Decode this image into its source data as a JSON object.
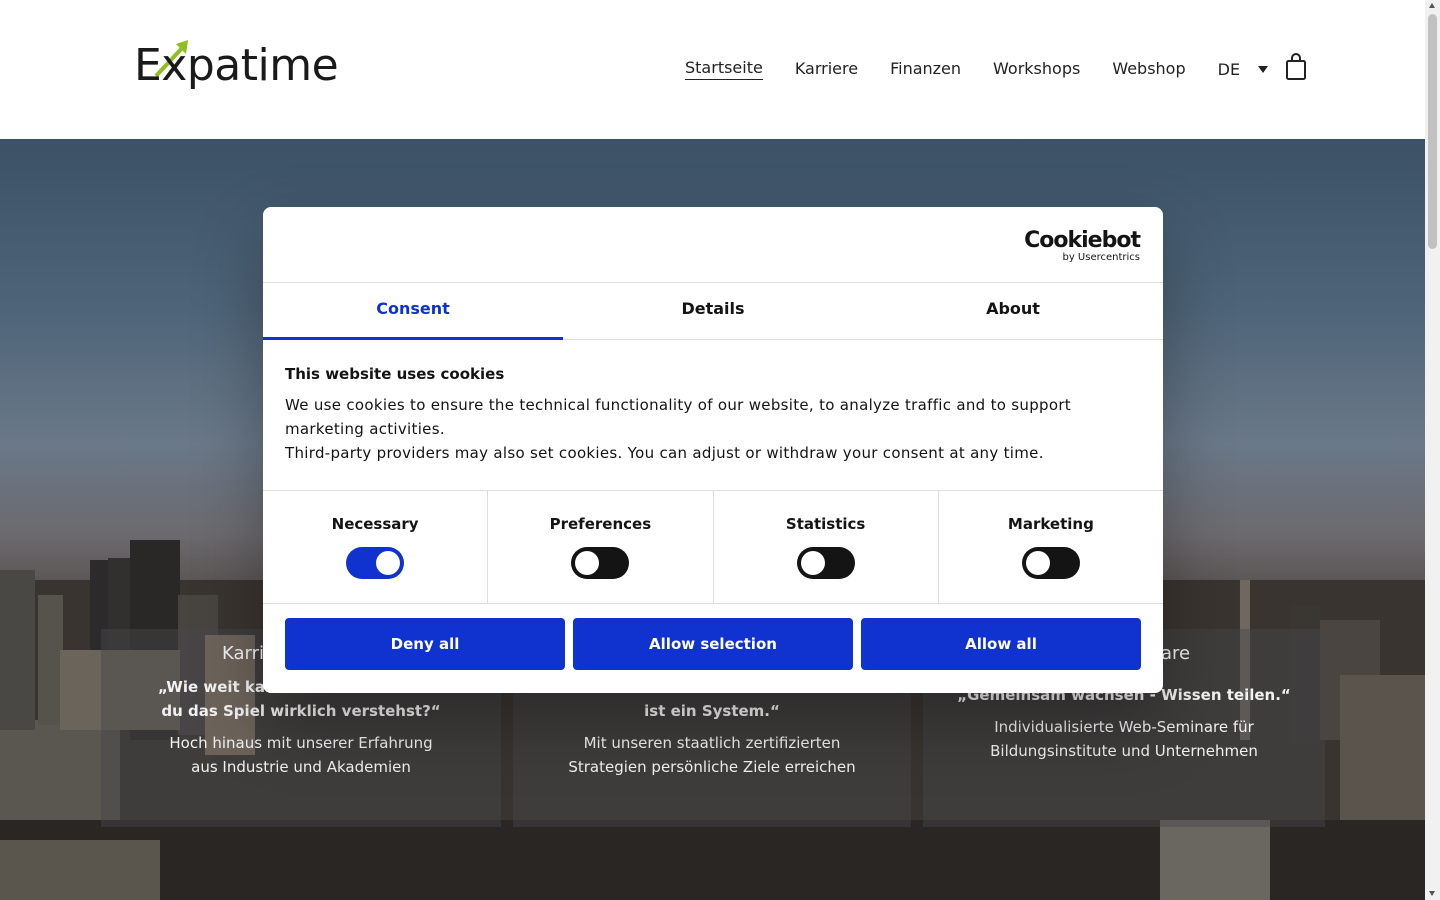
{
  "header": {
    "logo_text": "Expatime",
    "nav": [
      {
        "label": "Startseite",
        "active": true
      },
      {
        "label": "Karriere"
      },
      {
        "label": "Finanzen"
      },
      {
        "label": "Workshops"
      },
      {
        "label": "Webshop"
      }
    ],
    "language": "DE",
    "cart_icon": "shopping-bag-icon"
  },
  "hero": {
    "cards": [
      {
        "title": "Karri",
        "quote": "„Wie weit kan",
        "quote2": "du das Spiel wirklich verstehst?“",
        "desc": "Hoch hinaus mit unserer Erfahrung",
        "desc2": "aus Industrie und Akademien"
      },
      {
        "title": "",
        "quote": "",
        "quote2": "ist ein System.“",
        "desc": "Mit unseren staatlich zertifizierten",
        "desc2": "Strategien persönliche Ziele erreichen"
      },
      {
        "title": "are",
        "quote": "„Gemeinsam wachsen - Wissen teilen.“",
        "desc": "Individualisierte Web-Seminare für",
        "desc2": "Bildungsinstitute und Unternehmen"
      }
    ]
  },
  "dialog": {
    "brand": "Cookiebot",
    "brand_sub": "by Usercentrics",
    "tabs": [
      {
        "label": "Consent",
        "active": true
      },
      {
        "label": "Details"
      },
      {
        "label": "About"
      }
    ],
    "title": "This website uses cookies",
    "text_line1": "We use cookies to ensure the technical functionality of our website, to analyze traffic and to support marketing activities.",
    "text_line2": "Third-party providers may also set cookies. You can adjust or withdraw your consent at any time.",
    "categories": [
      {
        "label": "Necessary",
        "on": true
      },
      {
        "label": "Preferences",
        "on": false
      },
      {
        "label": "Statistics",
        "on": false
      },
      {
        "label": "Marketing",
        "on": false
      }
    ],
    "buttons": {
      "deny": "Deny all",
      "selection": "Allow selection",
      "allow": "Allow all"
    },
    "accent": "#1032cf"
  }
}
